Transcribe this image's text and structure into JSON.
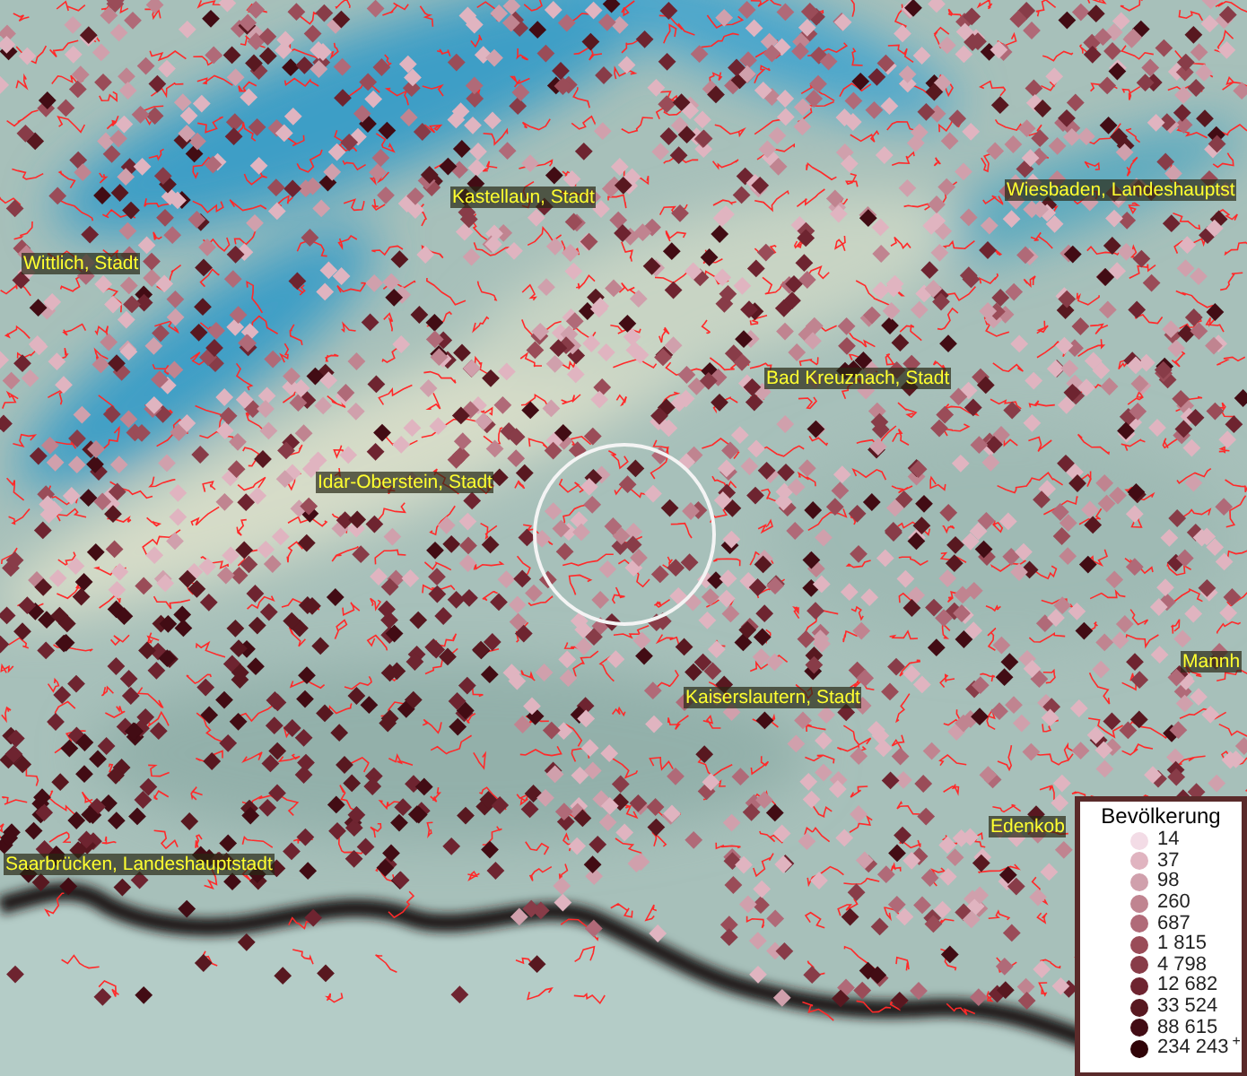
{
  "map": {
    "place_labels": [
      {
        "text": "Kastellaun, Stadt"
      },
      {
        "text": "Wiesbaden, Landeshauptst"
      },
      {
        "text": "Wittlich, Stadt"
      },
      {
        "text": "Bad Kreuznach, Stadt"
      },
      {
        "text": "Idar-Oberstein, Stadt"
      },
      {
        "text": "Mannh"
      },
      {
        "text": "Kaiserslautern, Stadt"
      },
      {
        "text": "Edenkob"
      },
      {
        "text": "Saarbrücken, Landeshauptstadt"
      }
    ]
  },
  "legend": {
    "title": "Bevölkerung",
    "items": [
      {
        "label": "14",
        "color": "#f3dce6"
      },
      {
        "label": "37",
        "color": "#e0b4c0"
      },
      {
        "label": "98",
        "color": "#d0a0ac"
      },
      {
        "label": "260",
        "color": "#c08490"
      },
      {
        "label": "687",
        "color": "#b06a78"
      },
      {
        "label": "1 815",
        "color": "#9a4c58"
      },
      {
        "label": "4 798",
        "color": "#883c48"
      },
      {
        "label": "12 682",
        "color": "#6e2430"
      },
      {
        "label": "33 524",
        "color": "#581820"
      },
      {
        "label": "88 615",
        "color": "#420c14"
      },
      {
        "label": "234 243$^{+}$",
        "color": "#300408"
      }
    ]
  }
}
